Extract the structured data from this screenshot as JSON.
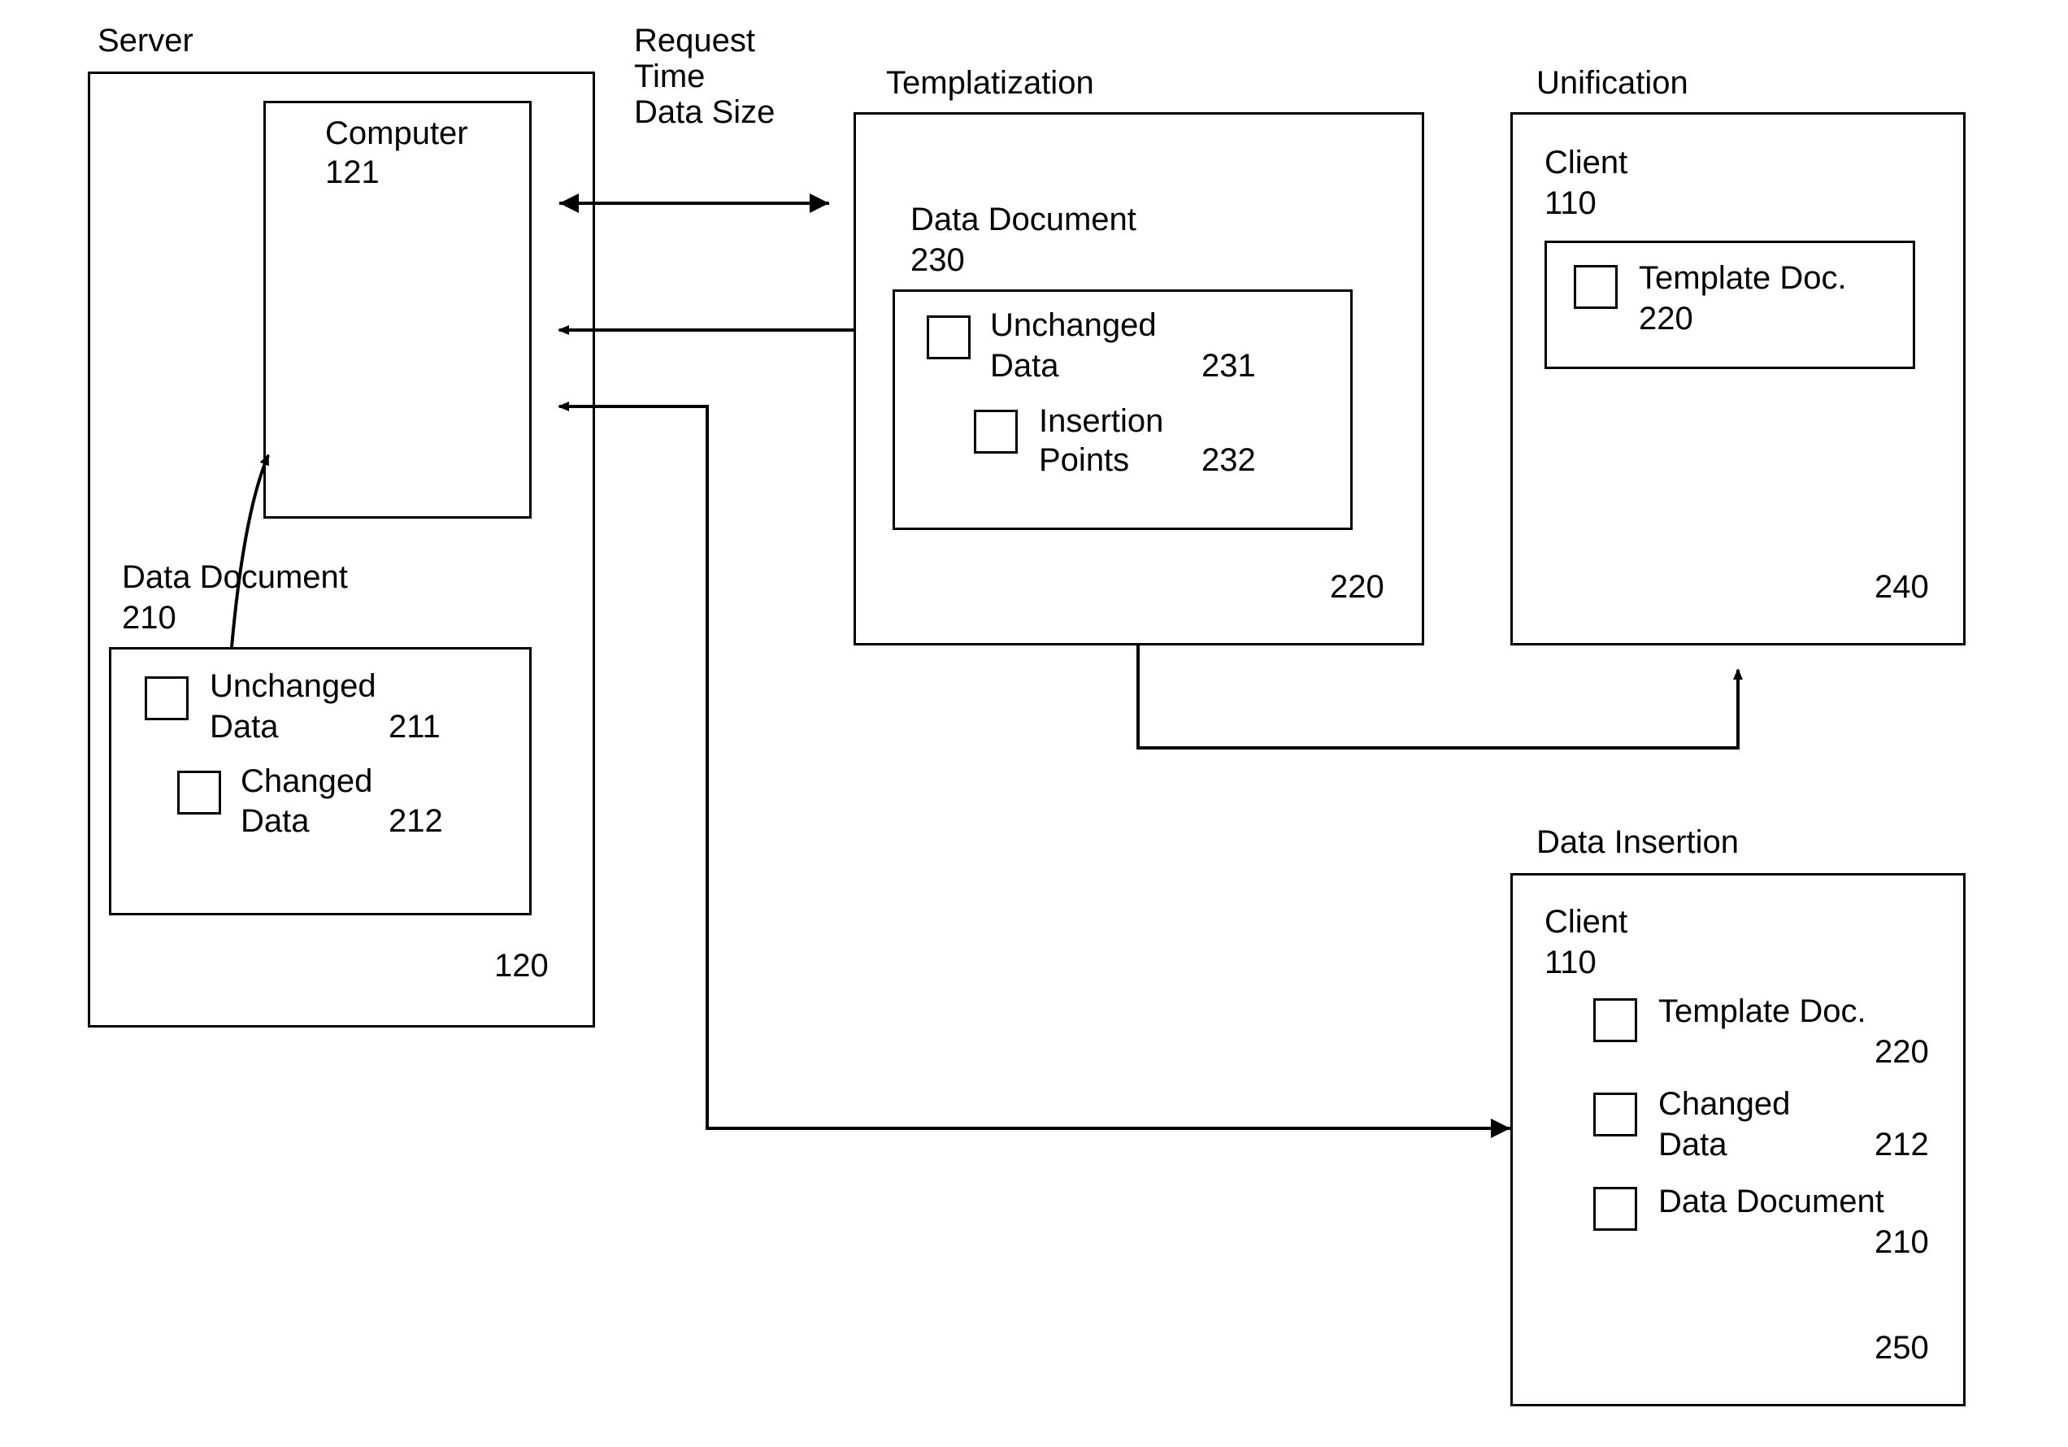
{
  "labels": {
    "server": "Server",
    "computer": "Computer",
    "computer_num": "121",
    "data_document_server": "Data Document",
    "data_document_server_num": "210",
    "unchanged_data": "Unchanged",
    "unchanged_data2": "Data",
    "unchanged_data_num": "211",
    "changed_data": "Changed",
    "changed_data2": "Data",
    "changed_data_num": "212",
    "server_num": "120",
    "request_text": "Request\nTime\nData Size",
    "templatization": "Templatization",
    "tmpl_data_document": "Data Document",
    "tmpl_data_document_num": "230",
    "tmpl_unchanged": "Unchanged",
    "tmpl_unchanged2": "Data",
    "tmpl_unchanged_num": "231",
    "tmpl_insertion": "Insertion",
    "tmpl_insertion2": "Points",
    "tmpl_insertion_num": "232",
    "tmpl_num": "220",
    "unification": "Unification",
    "uni_client": "Client",
    "uni_client_num": "110",
    "uni_template_doc": "Template Doc.",
    "uni_template_doc_num": "220",
    "uni_num": "240",
    "data_insertion": "Data Insertion",
    "di_client": "Client",
    "di_client_num": "110",
    "di_template_doc": "Template Doc.",
    "di_template_doc_num": "220",
    "di_changed": "Changed",
    "di_changed2": "Data",
    "di_changed_num": "212",
    "di_data_document": "Data Document",
    "di_data_document_num": "210",
    "di_num": "250"
  }
}
